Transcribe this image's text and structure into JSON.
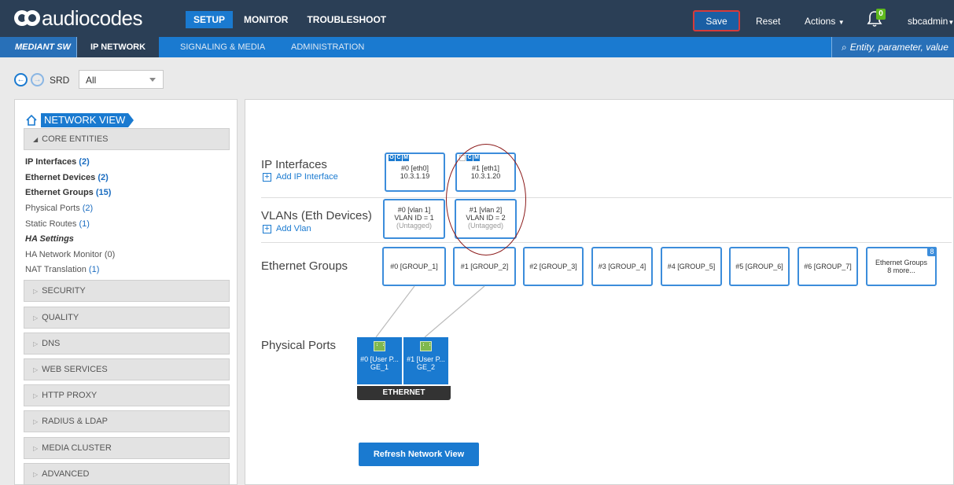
{
  "header": {
    "logo_text": "audiocodes",
    "tabs": [
      {
        "label": "SETUP"
      },
      {
        "label": "MONITOR"
      },
      {
        "label": "TROUBLESHOOT"
      }
    ],
    "save_label": "Save",
    "reset_label": "Reset",
    "actions_label": "Actions",
    "notifications_count": "0",
    "user_label": "sbcadmin"
  },
  "subnav": {
    "device": "MEDIANT SW",
    "active_tab": "IP NETWORK",
    "signaling_tab": "SIGNALING & MEDIA",
    "admin_tab": "ADMINISTRATION",
    "search_placeholder": "Entity, parameter, value"
  },
  "srd": {
    "label": "SRD",
    "value": "All"
  },
  "sidebar": {
    "title": "NETWORK VIEW",
    "core_title": "CORE ENTITIES",
    "entities": [
      {
        "label": "IP Interfaces",
        "count": "(2)"
      },
      {
        "label": "Ethernet Devices",
        "count": "(2)"
      },
      {
        "label": "Ethernet Groups",
        "count": "(15)"
      },
      {
        "label": "Physical Ports",
        "count": "(2)"
      },
      {
        "label": "Static Routes",
        "count": "(1)"
      },
      {
        "label": "HA Settings",
        "count": ""
      },
      {
        "label": "HA Network Monitor (0)",
        "count": ""
      },
      {
        "label": "NAT Translation",
        "count": "(1)"
      }
    ],
    "sections": [
      "SECURITY",
      "QUALITY",
      "DNS",
      "WEB SERVICES",
      "HTTP PROXY",
      "RADIUS & LDAP",
      "MEDIA CLUSTER",
      "ADVANCED"
    ]
  },
  "main": {
    "ip_interfaces_label": "IP Interfaces",
    "add_ip_interface": "Add IP Interface",
    "vlans_label": "VLANs (Eth Devices)",
    "add_vlan": "Add Vlan",
    "ethernet_groups_label": "Ethernet Groups",
    "physical_ports_label": "Physical Ports",
    "ip_interfaces": [
      {
        "name": "#0 [eth0]",
        "ip": "10.3.1.19",
        "tags": [
          "O",
          "C",
          "M"
        ]
      },
      {
        "name": "#1 [eth1]",
        "ip": "10.3.1.20",
        "tags": [
          "",
          "C",
          "M"
        ]
      }
    ],
    "vlans": [
      {
        "name": "#0 [vlan 1]",
        "vlan_id": "VLAN ID = 1",
        "tag": "(Untagged)"
      },
      {
        "name": "#1 [vlan 2]",
        "vlan_id": "VLAN ID = 2",
        "tag": "(Untagged)"
      }
    ],
    "ethernet_groups": [
      "#0 [GROUP_1]",
      "#1 [GROUP_2]",
      "#2 [GROUP_3]",
      "#3 [GROUP_4]",
      "#4 [GROUP_5]",
      "#5 [GROUP_6]",
      "#6 [GROUP_7]"
    ],
    "more_groups": {
      "line1": "Ethernet Groups",
      "line2": "8 more...",
      "badge": "8"
    },
    "physical_ports": [
      {
        "name": "#0 [User P...",
        "ge": "GE_1"
      },
      {
        "name": "#1 [User P...",
        "ge": "GE_2"
      }
    ],
    "ethernet_label": "ETHERNET",
    "refresh_label": "Refresh Network View"
  },
  "colors": {
    "topbar": "#2b3f56",
    "accent": "#1a7ad0",
    "highlight_red": "#8b1a1a",
    "badge_green": "#5fb91d"
  }
}
